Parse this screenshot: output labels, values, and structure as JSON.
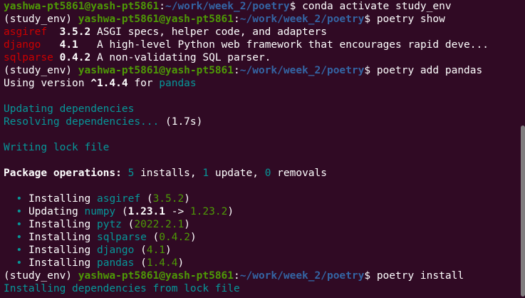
{
  "prompt": {
    "env": "(study_env) ",
    "user_host": "yashwa-pt5861@yash-pt5861",
    "sep": ":",
    "path": "~/work/week_2/poetry",
    "dollar": "$ "
  },
  "lines": {
    "l1": {
      "cmd": "conda activate study_env"
    },
    "l2": {
      "cmd": "poetry show"
    },
    "pkg1": {
      "name": "asgiref",
      "ver": "3.5.2",
      "desc": "ASGI specs, helper code, and adapters"
    },
    "pkg2": {
      "name": "django",
      "ver": "4.1",
      "desc": "A high-level Python web framework that encourages rapid deve..."
    },
    "pkg3": {
      "name": "sqlparse",
      "ver": "0.4.2",
      "desc": "A non-validating SQL parser."
    },
    "l6": {
      "cmd": "poetry add pandas"
    },
    "l7": {
      "prefix": "Using version ",
      "ver": "^1.4.4",
      "for": " for ",
      "pkg": "pandas"
    },
    "l9": "Updating dependencies",
    "l10": {
      "text": "Resolving dependencies... ",
      "time": "(1.7s)"
    },
    "l12": "Writing lock file",
    "l14": {
      "label": "Package operations: ",
      "n_installs": "5",
      "installs": " installs, ",
      "n_update": "1",
      "update": " update, ",
      "n_removals": "0",
      "removals": " removals"
    },
    "ops": [
      {
        "bullet": "•",
        "action": "Installing",
        "pkg": "asgiref",
        "ver": "3.5.2"
      },
      {
        "bullet": "•",
        "action": "Updating",
        "pkg": "numpy",
        "from": "1.23.1",
        "arrow": " -> ",
        "to": "1.23.2"
      },
      {
        "bullet": "•",
        "action": "Installing",
        "pkg": "pytz",
        "ver": "2022.2.1"
      },
      {
        "bullet": "•",
        "action": "Installing",
        "pkg": "sqlparse",
        "ver": "0.4.2"
      },
      {
        "bullet": "•",
        "action": "Installing",
        "pkg": "django",
        "ver": "4.1"
      },
      {
        "bullet": "•",
        "action": "Installing",
        "pkg": "pandas",
        "ver": "1.4.4"
      }
    ],
    "l22": {
      "cmd": "poetry install"
    },
    "l23": "Installing dependencies from lock file"
  },
  "colors": {
    "background": "#300a24",
    "prompt_user": "#4e9a06",
    "prompt_path": "#3465a4",
    "package_name": "#cc0000",
    "info_cyan": "#06989a",
    "version_green": "#4e9a06"
  }
}
